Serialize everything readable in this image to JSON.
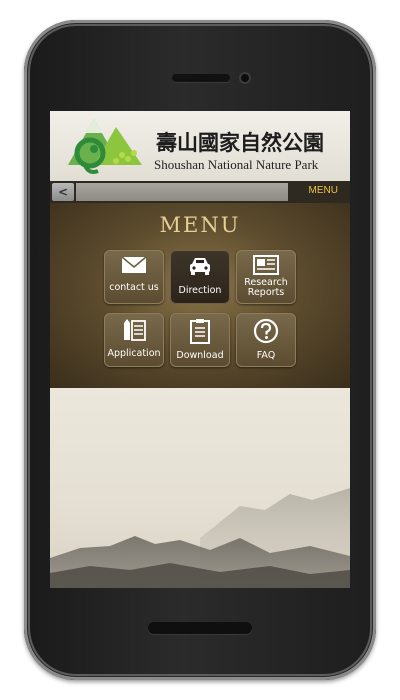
{
  "header": {
    "chinese_title": "壽山國家自然公園",
    "english_title": "Shoushan National Nature Park"
  },
  "navbar": {
    "back_label": "<",
    "menu_label": "MENU"
  },
  "menu": {
    "heading": "MENU",
    "tiles": [
      {
        "label": "contact us",
        "icon": "envelope-icon"
      },
      {
        "label": "Direction",
        "icon": "car-icon",
        "active": true
      },
      {
        "label": "Research Reports",
        "icon": "newspaper-icon"
      },
      {
        "label": "Application",
        "icon": "pencil-list-icon"
      },
      {
        "label": "Download",
        "icon": "clipboard-icon"
      },
      {
        "label": "FAQ",
        "icon": "question-icon"
      }
    ]
  },
  "colors": {
    "menu_accent": "#f0c040",
    "heading_gold": "#e6cf94",
    "panel_brown": "#5e4d2e"
  }
}
